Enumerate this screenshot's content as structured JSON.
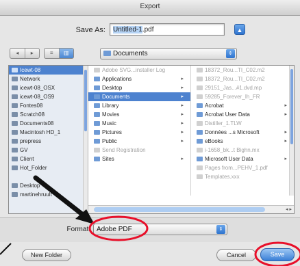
{
  "window": {
    "title": "Export"
  },
  "save_as": {
    "label": "Save As:",
    "value": "Untitled-1.pdf",
    "selected_part": "Untitled-1",
    "rest_part": ".pdf"
  },
  "toolbar": {
    "back_glyph": "◂",
    "forward_glyph": "▸",
    "view_list_glyph": "≡",
    "view_column_glyph": "▥",
    "location": "Documents",
    "expand_glyph": "▲",
    "popup_glyph": "⇕"
  },
  "sidebar": {
    "items": [
      {
        "label": "Icewt-08",
        "icon": "computer-icon",
        "selected": true
      },
      {
        "label": "Network",
        "icon": "network-icon"
      },
      {
        "label": "icewt-08_OSX",
        "icon": "hard-drive-icon"
      },
      {
        "label": "icewt-08_OS9",
        "icon": "hard-drive-icon"
      },
      {
        "label": "Fontes08",
        "icon": "hard-drive-icon"
      },
      {
        "label": "Scratch08",
        "icon": "hard-drive-icon"
      },
      {
        "label": "Documents08",
        "icon": "hard-drive-icon"
      },
      {
        "label": "Macintosh HD_1",
        "icon": "hard-drive-icon"
      },
      {
        "label": "prepress",
        "icon": "server-icon"
      },
      {
        "label": "GV",
        "icon": "server-icon"
      },
      {
        "label": "Client",
        "icon": "server-icon"
      },
      {
        "label": "Hot_Folder",
        "icon": "folder-icon"
      },
      {
        "label": "",
        "icon": ""
      },
      {
        "label": "Desktop",
        "icon": "desktop-icon"
      },
      {
        "label": "martinehruult",
        "icon": "home-icon"
      }
    ]
  },
  "column1": {
    "items": [
      {
        "label": "Adobe SVG...installer Log",
        "dim": true,
        "arrow": ""
      },
      {
        "label": "Applications",
        "dim": false,
        "arrow": "▸"
      },
      {
        "label": "Desktop",
        "dim": false,
        "arrow": "▸"
      },
      {
        "label": "Documents",
        "dim": false,
        "arrow": "▸",
        "selected": true
      },
      {
        "label": "Library",
        "dim": false,
        "arrow": "▸"
      },
      {
        "label": "Movies",
        "dim": false,
        "arrow": "▸"
      },
      {
        "label": "Music",
        "dim": false,
        "arrow": "▸"
      },
      {
        "label": "Pictures",
        "dim": false,
        "arrow": "▸"
      },
      {
        "label": "Public",
        "dim": false,
        "arrow": "▸"
      },
      {
        "label": "Send Registration",
        "dim": true,
        "arrow": ""
      },
      {
        "label": "Sites",
        "dim": false,
        "arrow": "▸"
      }
    ]
  },
  "column2": {
    "items": [
      {
        "label": "18372_Rou...TI_C02.m2",
        "dim": true,
        "arrow": ""
      },
      {
        "label": "18372_Rou...TI_C02.m2",
        "dim": true,
        "arrow": ""
      },
      {
        "label": "29151_Jas...#1.dvd.mp",
        "dim": true,
        "arrow": ""
      },
      {
        "label": "59285_Forever_Ih_FR",
        "dim": true,
        "arrow": ""
      },
      {
        "label": "Acrobat",
        "dim": false,
        "arrow": "▸"
      },
      {
        "label": "Acrobat User Data",
        "dim": false,
        "arrow": "▸"
      },
      {
        "label": "Distiller_1.TLW",
        "dim": true,
        "arrow": ""
      },
      {
        "label": "Données ...s Microsoft",
        "dim": false,
        "arrow": "▸"
      },
      {
        "label": "eBooks",
        "dim": false,
        "arrow": "▸"
      },
      {
        "label": "i-1658_bk...t Bighn.mx",
        "dim": true,
        "arrow": ""
      },
      {
        "label": "Microsoft User Data",
        "dim": false,
        "arrow": "▸"
      },
      {
        "label": "Pages from...PEHV_1.pdf",
        "dim": true,
        "arrow": ""
      },
      {
        "label": "Templates.xxx",
        "dim": true,
        "arrow": ""
      }
    ]
  },
  "hscroll": {
    "buttons": "◂ ▸"
  },
  "format": {
    "label": "Format:",
    "value": "Adobe PDF"
  },
  "buttons": {
    "new_folder": "New Folder",
    "cancel": "Cancel",
    "save": "Save"
  },
  "annotation_colors": {
    "highlight": "#e8102a",
    "arrow": "#111111"
  }
}
